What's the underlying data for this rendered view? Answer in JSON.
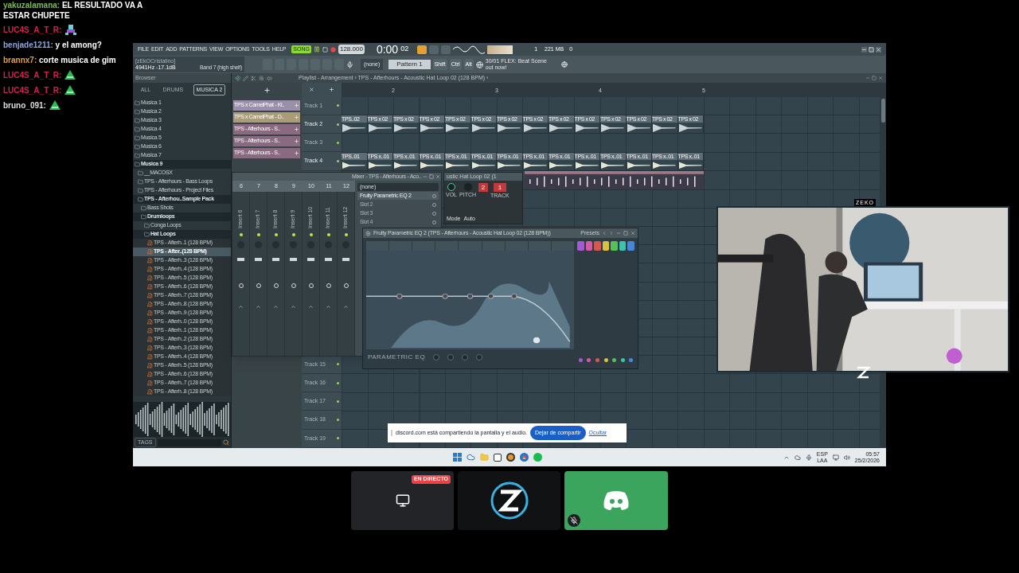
{
  "chat": [
    {
      "user": "yakuzalamana:",
      "color": "#7dbb5a",
      "kind": "text",
      "message": "EL RESULTADO VA A ESTAR CHUPETE"
    },
    {
      "user": "LUC4S_A_T_R:",
      "color": "#d4204f",
      "kind": "figure-emote"
    },
    {
      "user": "benjade1211:",
      "color": "#8ea6dc",
      "kind": "text",
      "message": "y el among?"
    },
    {
      "user": "brannx7:",
      "color": "#e0a040",
      "kind": "text",
      "message": "corte musica de gim"
    },
    {
      "user": "LUC4S_A_T_R:",
      "color": "#d4204f",
      "kind": "pyramid-emote"
    },
    {
      "user": "LUC4S_A_T_R:",
      "color": "#d4204f",
      "kind": "pyramid-emote"
    },
    {
      "user": "bruno_091:",
      "color": "#dddddd",
      "kind": "pyramid-emote"
    }
  ],
  "fl": {
    "menu": [
      "FILE",
      "EDIT",
      "ADD",
      "PATTERNS",
      "VIEW",
      "OPTIONS",
      "TOOLS",
      "HELP"
    ],
    "transport": {
      "song": "SONG",
      "tempo": "128.000",
      "time": "0:00",
      "time_sub": "02"
    },
    "memory": "221 MB",
    "cpu": "1",
    "voices": "0",
    "hint": {
      "title": "[zEkOCristalino]",
      "value": "4941Hz -17.1dB",
      "detail": "Band 7 (high shelf)"
    },
    "pattern_select": "(none)",
    "pattern": "Pattern 1",
    "keys": [
      "Shift",
      "Ctrl",
      "Alt"
    ],
    "news": {
      "date": "30/01",
      "text": "FLEX: Beat Scene out now!"
    }
  },
  "browser": {
    "title": "Browser",
    "tabs": [
      {
        "label": "ALL",
        "selected": false
      },
      {
        "label": "DRUMS",
        "selected": false
      },
      {
        "label": "MUSICA 2",
        "selected": true
      }
    ],
    "tree": [
      {
        "kind": "folder",
        "label": "Musica 1",
        "expanded": false,
        "selected": false
      },
      {
        "kind": "folder",
        "label": "Musica 2",
        "expanded": false,
        "selected": false
      },
      {
        "kind": "folder",
        "label": "Musica 3",
        "expanded": false,
        "selected": false
      },
      {
        "kind": "folder",
        "label": "Musica 4",
        "expanded": false,
        "selected": false
      },
      {
        "kind": "folder",
        "label": "Musica 5",
        "expanded": false,
        "selected": false
      },
      {
        "kind": "folder",
        "label": "Musica 6",
        "expanded": false,
        "selected": false
      },
      {
        "kind": "folder",
        "label": "Musica 7",
        "expanded": false,
        "selected": false
      },
      {
        "kind": "folder",
        "label": "Musica 9",
        "expanded": true,
        "selected": false,
        "children": [
          {
            "kind": "folder",
            "label": "__MACOSX",
            "expanded": false,
            "selected": false
          },
          {
            "kind": "folder",
            "label": "TPS - Afterhours - Bass Loops",
            "expanded": false,
            "selected": false
          },
          {
            "kind": "folder",
            "label": "TPS - Afterhours - Project Files",
            "expanded": false,
            "selected": false
          },
          {
            "kind": "folder",
            "label": "TPS - Afterhou..Sample Pack",
            "expanded": true,
            "selected": false,
            "children": [
              {
                "kind": "folder",
                "label": "Bass Shots",
                "expanded": false,
                "selected": false
              },
              {
                "kind": "folder",
                "label": "Drumloops",
                "expanded": true,
                "selected": false,
                "children": [
                  {
                    "kind": "folder",
                    "label": "Conga Loops",
                    "expanded": false,
                    "selected": false
                  },
                  {
                    "kind": "folder",
                    "label": "Hat Loops",
                    "expanded": true,
                    "selected": false,
                    "children": [
                      {
                        "kind": "file",
                        "label": "TPS - Afterh..1 (128 BPM)",
                        "selected": false
                      },
                      {
                        "kind": "file",
                        "label": "TPS - After..(128 BPM)",
                        "selected": true
                      },
                      {
                        "kind": "file",
                        "label": "TPS - Afterh..3 (128 BPM)",
                        "selected": false
                      },
                      {
                        "kind": "file",
                        "label": "TPS - Afterh..4 (128 BPM)",
                        "selected": false
                      },
                      {
                        "kind": "file",
                        "label": "TPS - Afterh..5 (128 BPM)",
                        "selected": false
                      },
                      {
                        "kind": "file",
                        "label": "TPS - Afterh..6 (128 BPM)",
                        "selected": false
                      },
                      {
                        "kind": "file",
                        "label": "TPS - Afterh..7 (128 BPM)",
                        "selected": false
                      },
                      {
                        "kind": "file",
                        "label": "TPS - Afterh..8 (128 BPM)",
                        "selected": false
                      },
                      {
                        "kind": "file",
                        "label": "TPS - Afterh..9 (128 BPM)",
                        "selected": false
                      },
                      {
                        "kind": "file",
                        "label": "TPS - Afterh..0 (128 BPM)",
                        "selected": false
                      },
                      {
                        "kind": "file",
                        "label": "TPS - Afterh..1 (128 BPM)",
                        "selected": false
                      },
                      {
                        "kind": "file",
                        "label": "TPS - Afterh..2 (128 BPM)",
                        "selected": false
                      },
                      {
                        "kind": "file",
                        "label": "TPS - Afterh..3 (128 BPM)",
                        "selected": false
                      },
                      {
                        "kind": "file",
                        "label": "TPS - Afterh..4 (128 BPM)",
                        "selected": false
                      },
                      {
                        "kind": "file",
                        "label": "TPS - Afterh..5 (128 BPM)",
                        "selected": false
                      },
                      {
                        "kind": "file",
                        "label": "TPS - Afterh..6 (128 BPM)",
                        "selected": false
                      },
                      {
                        "kind": "file",
                        "label": "TPS - Afterh..7 (128 BPM)",
                        "selected": false
                      },
                      {
                        "kind": "file",
                        "label": "TPS - Afterh..8 (128 BPM)",
                        "selected": false
                      }
                    ]
                  }
                ]
              }
            ]
          }
        ]
      }
    ],
    "tags": "TAGS"
  },
  "playlist": {
    "title": "Playlist - Arrangement › TPS - Afterhours - Acoustic Hat Loop 02 (128 BPM) ›",
    "patterns": [
      {
        "label": "TPS x CamelPhat - Ki..",
        "color": "#9a90aa"
      },
      {
        "label": "TPS x CamelPhat - D..",
        "color": "#a99c76"
      },
      {
        "label": "TPS - Afterhours - S..",
        "color": "#8a6a80"
      },
      {
        "label": "TPS - Afterhours - S..",
        "color": "#8a6a80"
      },
      {
        "label": "TPS - Afterhours - S..",
        "color": "#8a6a80"
      }
    ],
    "ruler": [
      "2",
      "3",
      "4",
      "5"
    ],
    "tracks": [
      {
        "label": "Track 1"
      },
      {
        "label": "Track 2",
        "clips": [
          "TPS..02",
          "TPS x 02",
          "TPS x 02",
          "TPS x 02",
          "TPS x 02",
          "TPS x 02",
          "TPS x 02",
          "TPS x 02",
          "TPS x 02",
          "TPS x 02",
          "TPS x 02",
          "TPS x 02",
          "TPS x 02",
          "TPS x 02"
        ]
      },
      {
        "label": "Track 3"
      },
      {
        "label": "Track 4",
        "clips": [
          "TPS..01",
          "TPS x..01",
          "TPS x..01",
          "TPS x..01",
          "TPS x..01",
          "TPS x..01",
          "TPS x..01",
          "TPS x..01",
          "TPS x..01",
          "TPS x..01",
          "TPS x..01",
          "TPS x..01",
          "TPS x..01",
          "TPS x..01"
        ]
      }
    ],
    "bottom_tracks": [
      {
        "label": "Track 15"
      },
      {
        "label": "Track 16"
      },
      {
        "label": "Track 17"
      },
      {
        "label": "Track 18"
      },
      {
        "label": "Track 19"
      }
    ]
  },
  "mixer": {
    "title": "Mixer - TPS - Afterhours - Aco..",
    "strips": [
      {
        "number": "6",
        "name": "Insert 6"
      },
      {
        "number": "7",
        "name": "Insert 7"
      },
      {
        "number": "8",
        "name": "Insert 8"
      },
      {
        "number": "9",
        "name": "Insert 9"
      },
      {
        "number": "10",
        "name": "Insert 10"
      },
      {
        "number": "11",
        "name": "Insert 11"
      },
      {
        "number": "12",
        "name": "Insert 12"
      }
    ],
    "routing": "(none)",
    "slots": [
      {
        "label": "Fruity Parametric EQ 2",
        "active": true
      },
      {
        "label": "Slot 2",
        "active": false
      },
      {
        "label": "Slot 3",
        "active": false
      },
      {
        "label": "Slot 4",
        "active": false
      }
    ]
  },
  "sampler": {
    "title": "ustic Hat Loop 02 (1",
    "pitch": "2",
    "track": "1",
    "labels": [
      "VOL",
      "PITCH",
      "TRACK"
    ],
    "mode": "Mode",
    "mode_value": "Auto"
  },
  "eq": {
    "title": "Fruity Parametric EQ 2 (TPS - Afterhours - Acoustic Hat Loop 02 (128 BPM))",
    "presets": "Presets",
    "logo": "PARAMETRIC EQ",
    "bands": [
      {
        "color": "#a35ad6"
      },
      {
        "color": "#d45aa8"
      },
      {
        "color": "#d4584f"
      },
      {
        "color": "#d6c23e"
      },
      {
        "color": "#54c254"
      },
      {
        "color": "#3ec2b0"
      },
      {
        "color": "#4a86d6"
      }
    ]
  },
  "notice": {
    "text": "discord.com está compartiendo la pantalla y el audio.",
    "button": "Dejar de compartir",
    "link": "Ocultar"
  },
  "taskbar": {
    "lang": "ESP",
    "layout": "LAA",
    "time": "05:57",
    "date": "25/2/2026"
  },
  "webcam": {
    "label": "ZEKO"
  },
  "tiles": [
    {
      "kind": "screen",
      "badge": "EN DIRECTO"
    },
    {
      "kind": "logo"
    },
    {
      "kind": "voice",
      "muted": true
    }
  ]
}
